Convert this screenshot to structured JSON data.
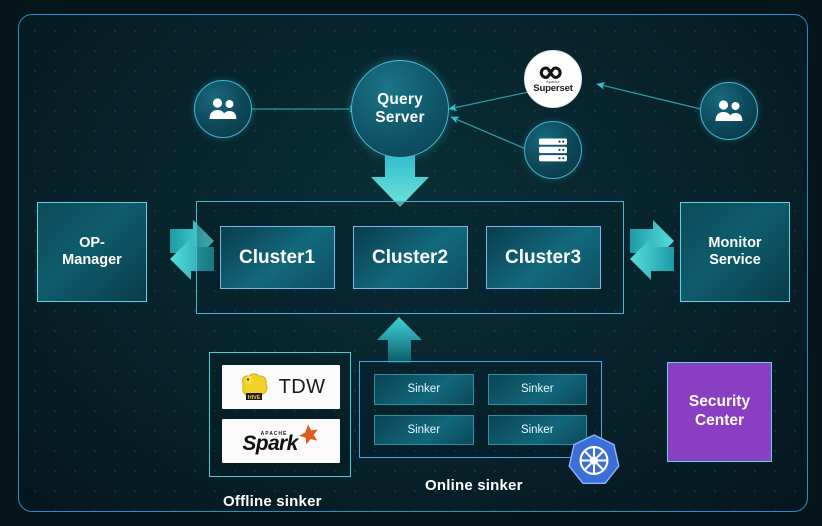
{
  "diagram": {
    "title": "Data platform architecture",
    "background_color": "#06141c",
    "panel_border_color": "#2a8fc4",
    "accent_color": "#46bcd6",
    "security_color": "#8a3fc2"
  },
  "top_row": {
    "left_users": {
      "icon": "users-icon",
      "label": ""
    },
    "query_server": {
      "label": "Query\nServer",
      "line1": "Query",
      "line2": "Server"
    },
    "superset": {
      "label": "Superset",
      "sub": "Apache",
      "icon": "superset-infinity-icon"
    },
    "database": {
      "icon": "database-server-icon",
      "label": ""
    },
    "right_users": {
      "icon": "users-icon",
      "label": ""
    }
  },
  "middle_row": {
    "op_manager": {
      "line1": "OP-",
      "line2": "Manager"
    },
    "clusters": [
      {
        "label": "Cluster1"
      },
      {
        "label": "Cluster2"
      },
      {
        "label": "Cluster3"
      }
    ],
    "monitor_service": {
      "line1": "Monitor",
      "line2": "Service"
    }
  },
  "bottom_row": {
    "offline_sinker": {
      "caption": "Offline sinker",
      "items": [
        {
          "label": "TDW",
          "icon": "hive-bee-icon"
        },
        {
          "label": "Spark",
          "sub": "APACHE",
          "icon": "spark-star-icon"
        }
      ]
    },
    "online_sinker": {
      "caption": "Online sinker",
      "sinkers": [
        {
          "label": "Sinker"
        },
        {
          "label": "Sinker"
        },
        {
          "label": "Sinker"
        },
        {
          "label": "Sinker"
        }
      ],
      "platform_icon": "kubernetes-icon"
    },
    "security_center": {
      "line1": "Security",
      "line2": "Center"
    }
  }
}
